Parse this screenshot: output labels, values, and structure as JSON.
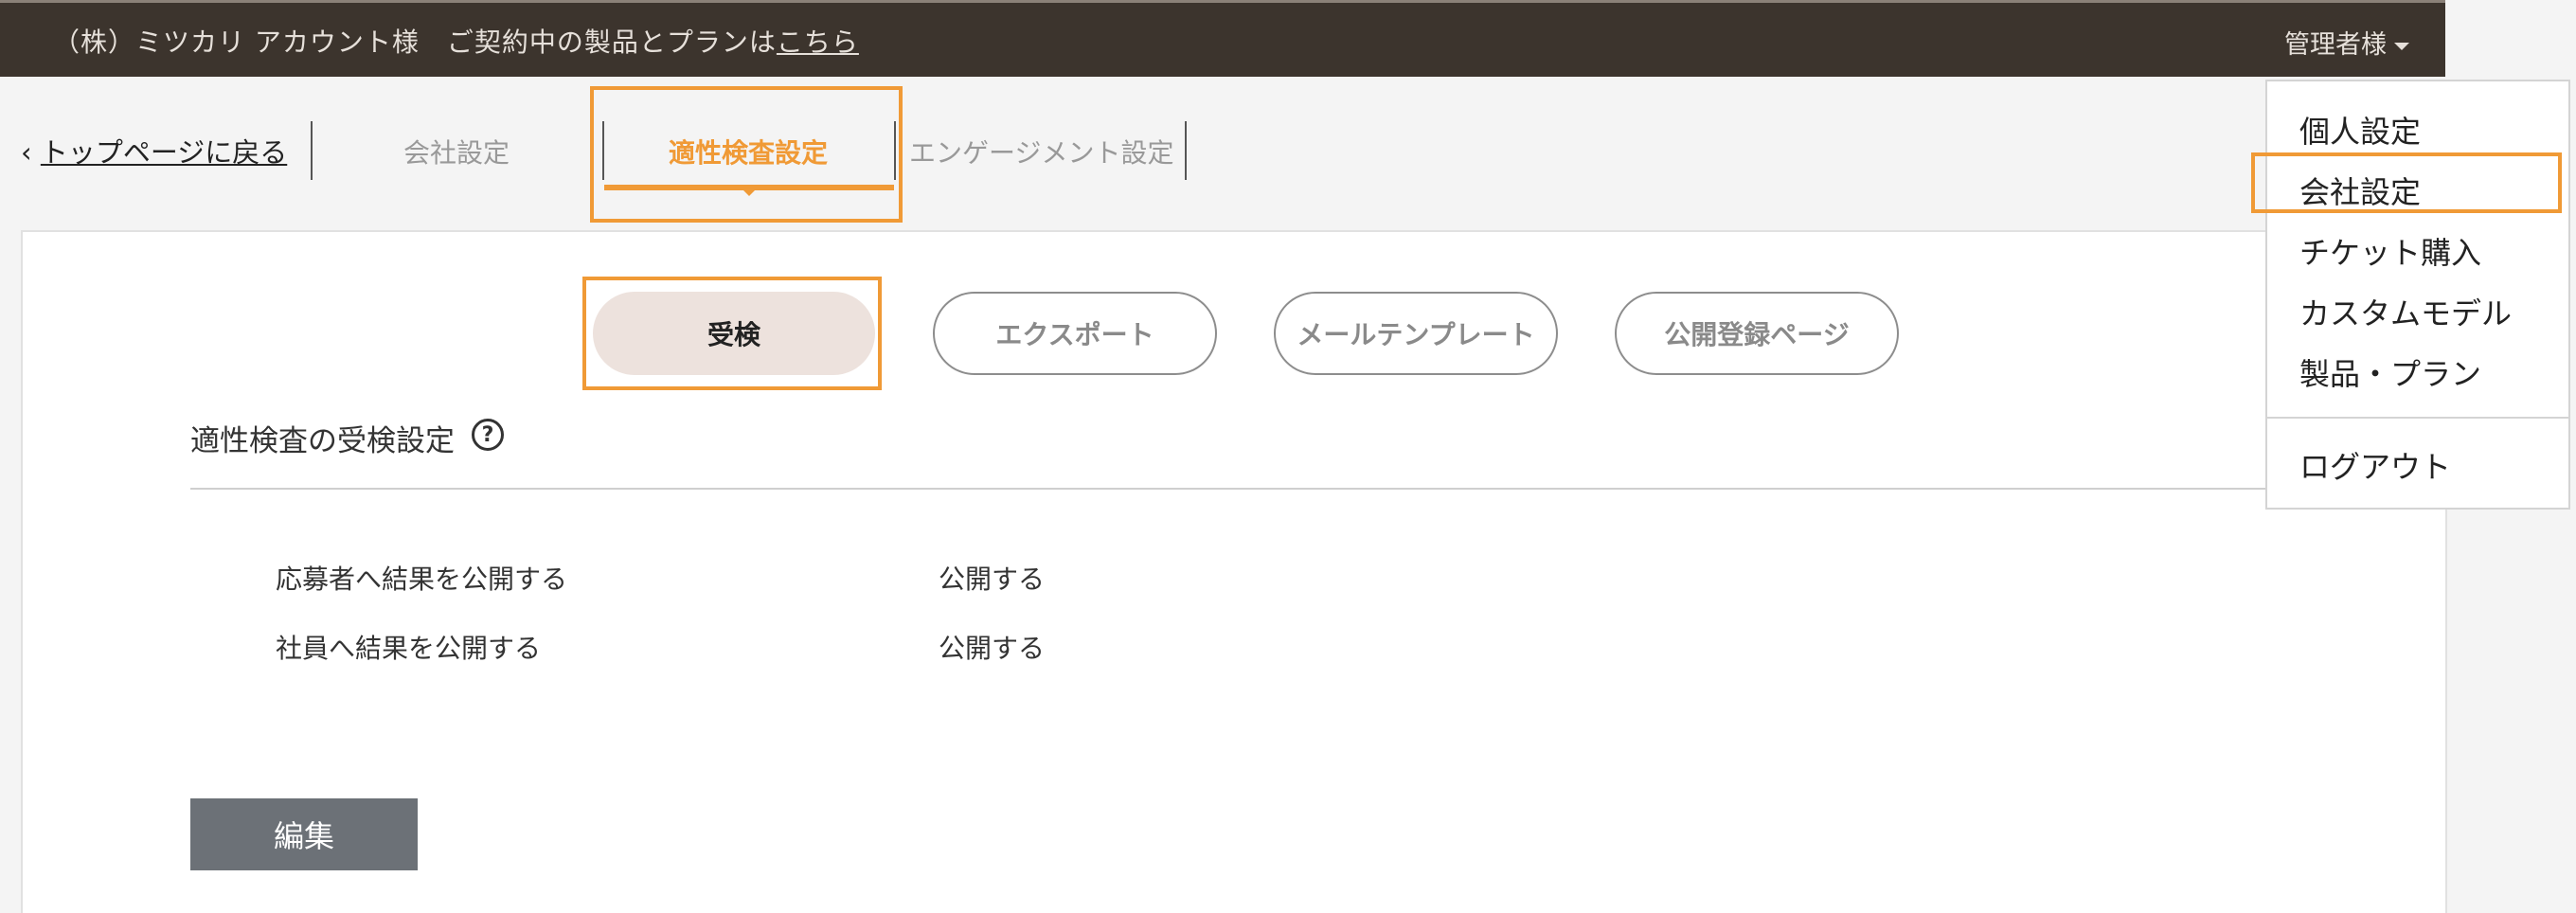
{
  "header": {
    "company_name": "（株）ミツカリ アカウント様　ご契約中の製品とプランは",
    "company_link": "こちら",
    "user_menu_label": "管理者様"
  },
  "subnav": {
    "back_chevron": "‹",
    "back_label": "トップページに戻る",
    "tabs": [
      {
        "label": "会社設定"
      },
      {
        "label": "適性検査設定"
      },
      {
        "label": "エンゲージメント設定"
      }
    ]
  },
  "content_tabs": [
    {
      "label": "受検"
    },
    {
      "label": "エクスポート"
    },
    {
      "label": "メールテンプレート"
    },
    {
      "label": "公開登録ページ"
    }
  ],
  "section": {
    "title": "適性検査の受検設定",
    "help_glyph": "?",
    "rows": [
      {
        "label": "応募者へ結果を公開する",
        "value": "公開する"
      },
      {
        "label": "社員へ結果を公開する",
        "value": "公開する"
      }
    ],
    "edit_label": "編集"
  },
  "user_dropdown": {
    "items": [
      {
        "label": "個人設定"
      },
      {
        "label": "会社設定"
      },
      {
        "label": "チケット購入"
      },
      {
        "label": "カスタムモデル"
      },
      {
        "label": "製品・プラン"
      }
    ],
    "logout_label": "ログアウト"
  },
  "colors": {
    "topbar_bg": "#3c342d",
    "accent": "#f09a36",
    "active_pill_bg": "#ede2dd",
    "edit_button_bg": "#6c7177"
  }
}
